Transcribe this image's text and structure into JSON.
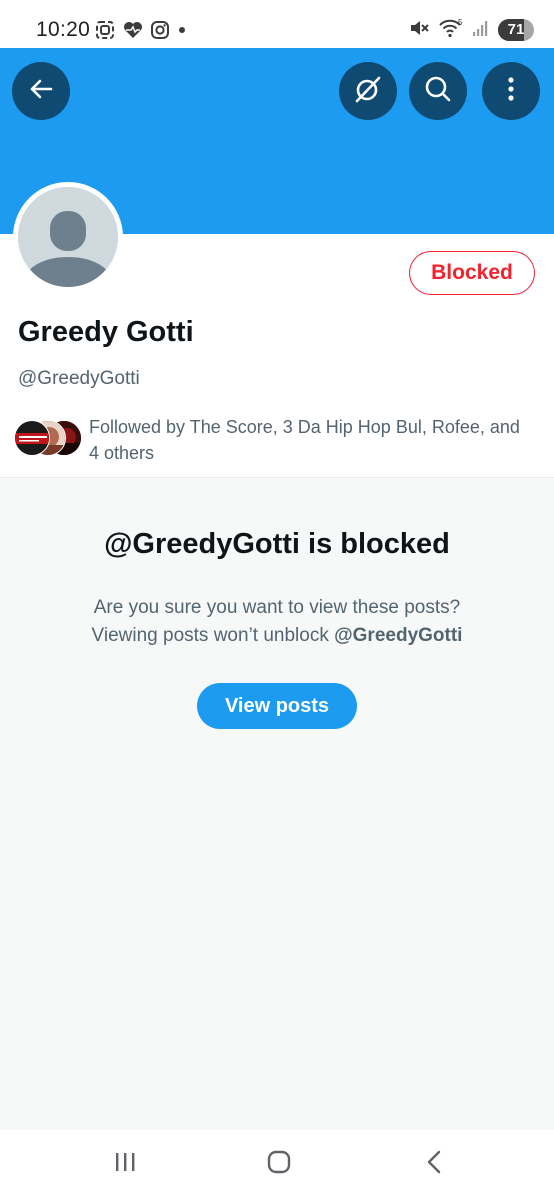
{
  "status_bar": {
    "time": "10:20",
    "battery_level": "71",
    "left_icons": [
      "screenshot-icon",
      "heart-health-icon",
      "instagram-icon",
      "notification-dot-icon"
    ],
    "right_icons": [
      "mute-icon",
      "wifi-icon",
      "signal-icon",
      "battery-icon"
    ]
  },
  "header": {
    "back_icon": "arrow-left-icon",
    "actions": [
      "grok-icon",
      "search-icon",
      "more-vertical-icon"
    ],
    "banner_color": "#1d9bf0"
  },
  "profile": {
    "display_name": "Greedy Gotti",
    "handle": "@GreedyGotti",
    "blocked_label": "Blocked",
    "followed_by_text": "Followed by The Score, 3 Da Hip Hop Bul, Rofee, and 4 others"
  },
  "blocked_notice": {
    "title": "@GreedyGotti is blocked",
    "line1": "Are you sure you want to view these posts?",
    "line2_prefix": "Viewing posts won’t unblock ",
    "line2_handle": "@GreedyGotti",
    "button_label": "View posts"
  },
  "nav_bar": {
    "items": [
      "recent-apps-icon",
      "home-icon",
      "back-icon"
    ]
  },
  "colors": {
    "accent": "#1d9bf0",
    "danger": "#f4212e",
    "secondary_text": "#536471",
    "header_button": "#0f4a72"
  }
}
